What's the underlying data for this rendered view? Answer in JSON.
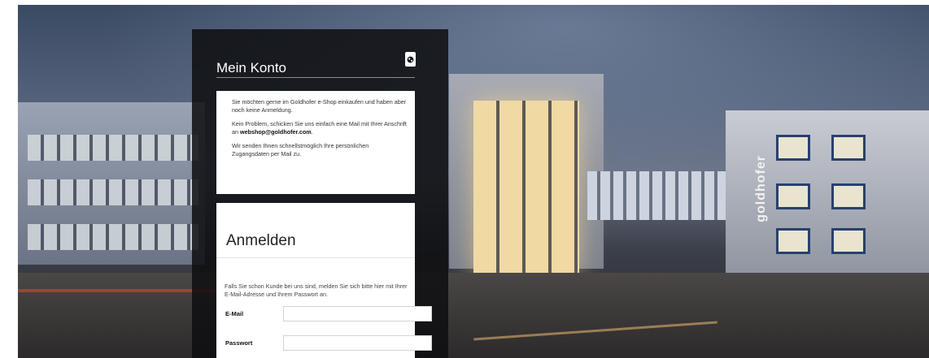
{
  "panel": {
    "title": "Mein Konto",
    "icon": "globe-icon"
  },
  "info": {
    "para1": "Sie möchten gerne im Goldhofer e-Shop einkaufen und haben aber noch keine Anmeldung.",
    "para2_text": "Kein Problem, schicken Sie uns einfach eine Mail mit Ihrer Anschrift an ",
    "para2_email": "webshop@goldhofer.com",
    "para2_end": ".",
    "para3": "Wir senden Ihnen schnellstmöglich Ihre persönlichen Zugangsdaten per Mail zu."
  },
  "login": {
    "title": "Anmelden",
    "description": "Falls Sie schon Kunde bei uns sind, melden Sie sich bitte hier mit Ihrer E-Mail-Adresse und Ihrem Passwort an.",
    "email_label": "E-Mail",
    "email_value": "",
    "password_label": "Passwort",
    "password_value": ""
  },
  "background": {
    "building_logo": "goldhofer"
  }
}
